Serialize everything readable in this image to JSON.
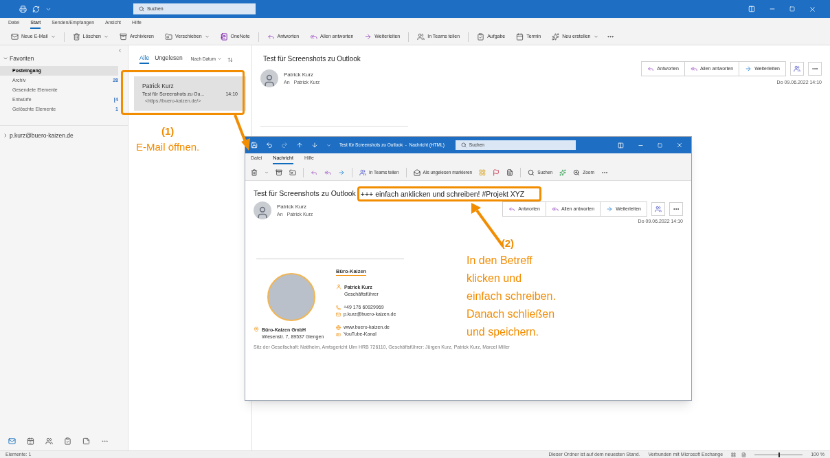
{
  "title_bar": {
    "search_placeholder": "Suchen"
  },
  "menu_tabs": [
    {
      "label": "Datei",
      "selected": false
    },
    {
      "label": "Start",
      "selected": true
    },
    {
      "label": "Senden/Empfangen",
      "selected": false
    },
    {
      "label": "Ansicht",
      "selected": false
    },
    {
      "label": "Hilfe",
      "selected": false
    }
  ],
  "toolbar": [
    {
      "label": "Neue E-Mail",
      "dropdown": true
    },
    {
      "label": "Löschen",
      "dropdown": true
    },
    {
      "label": "Archivieren",
      "dropdown": false
    },
    {
      "label": "Verschieben",
      "dropdown": true
    },
    {
      "label": "OneNote",
      "dropdown": false
    },
    {
      "label": "Antworten",
      "dropdown": false
    },
    {
      "label": "Allen antworten",
      "dropdown": false
    },
    {
      "label": "Weiterleiten",
      "dropdown": false
    },
    {
      "label": "In Teams teilen",
      "dropdown": false
    },
    {
      "label": "Aufgabe",
      "dropdown": false
    },
    {
      "label": "Termin",
      "dropdown": false
    },
    {
      "label": "Neu erstellen",
      "dropdown": true
    }
  ],
  "folders": {
    "favorites_label": "Favoriten",
    "expanded": true,
    "items": [
      {
        "name": "Posteingang",
        "selected": true
      },
      {
        "name": "Archiv",
        "count": "28",
        "selected": false
      },
      {
        "name": "Gesendete Elemente",
        "selected": false
      },
      {
        "name": "Entwürfe",
        "count": "[4",
        "selected": false
      },
      {
        "name": "Gelöschte Elemente",
        "count": "1",
        "selected": false
      }
    ],
    "account": "p.kurz@buero-kaizen.de",
    "account_expanded": false
  },
  "mail_list": {
    "filters": [
      {
        "label": "Alle",
        "selected": true
      },
      {
        "label": "Ungelesen",
        "selected": false
      }
    ],
    "sort": "Nach Datum",
    "items": [
      {
        "sender": "Patrick Kurz",
        "subject": "Test für Screenshots zu Ou...",
        "time": "14:10",
        "preview": "<https://buero-kaizen.de/>",
        "selected": true
      }
    ]
  },
  "reading_pane": {
    "subject": "Test für Screenshots zu Outlook",
    "sender": "Patrick Kurz",
    "to_label": "An",
    "to": "Patrick Kurz",
    "actions": [
      "Antworten",
      "Allen antworten",
      "Weiterleiten"
    ],
    "date": "Do 09.06.2022 14:10"
  },
  "message_window": {
    "title": "Test für Screenshots zu Outlook  -  Nachricht (HTML)",
    "search_placeholder": "Suchen",
    "tabs": [
      {
        "label": "Datei",
        "selected": false
      },
      {
        "label": "Nachricht",
        "selected": true
      },
      {
        "label": "Hilfe",
        "selected": false
      }
    ],
    "toolbar": [
      "In Teams teilen",
      "Als ungelesen markieren",
      "Suchen",
      "Zoom"
    ],
    "subject": "Test für Screenshots zu Outlook",
    "subject_added": "+++ einfach anklicken und schreiben! #Projekt XYZ",
    "sender": "Patrick Kurz",
    "to_label": "An",
    "to": "Patrick Kurz",
    "actions": [
      "Antworten",
      "Allen antworten",
      "Weiterleiten"
    ],
    "date": "Do 09.06.2022 14:10",
    "signature": {
      "brand": "Büro-Kaizen",
      "name": "Patrick Kurz",
      "role": "Geschäftsführer",
      "phone": "+49 176 60929969",
      "email": "p.kurz@buero-kaizen.de",
      "company": "Büro-Kaizen GmbH",
      "address": "Wiesenstr. 7, 89537 Giengen",
      "website": "www.buero-kaizen.de",
      "youtube": "YouTube-Kanal",
      "legal": "Sitz der Gesellschaft: Nattheim, Amtsgericht Ulm HRB 726110, Geschäftsführer: Jürgen Kurz, Patrick Kurz, Marcel Miller"
    }
  },
  "annotations": [
    {
      "number": "(1)",
      "text": "E-Mail öffnen."
    },
    {
      "number": "(2)",
      "text": "In den Betreff\nklicken und\neinfach schreiben.\nDanach schließen\nund speichern."
    }
  ],
  "status_bar": {
    "items": "Elemente: 1",
    "sync": "Dieser Ordner ist auf dem neuesten Stand.",
    "connection": "Verbunden mit Microsoft Exchange",
    "zoom": "100 %",
    "zoom_level": {
      "level": 0.5
    }
  }
}
